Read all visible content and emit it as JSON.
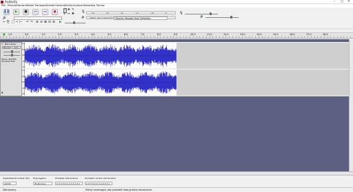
{
  "window": {
    "title": "Audacity",
    "controls": [
      "–",
      "□",
      "✕"
    ]
  },
  "menu": [
    "Plik",
    "Edycja",
    "Zaznacz",
    "Widok",
    "Transport",
    "Ścieżki",
    "Generuj",
    "Efekty",
    "Analiza",
    "Narzędzia",
    "Pomoc"
  ],
  "toolbar": {
    "transport": [
      {
        "name": "pause",
        "glyph": "❚❚"
      },
      {
        "name": "play",
        "glyph": "▶"
      },
      {
        "name": "stop",
        "glyph": "■"
      },
      {
        "name": "skip-start",
        "glyph": "⏮"
      },
      {
        "name": "skip-end",
        "glyph": "⏭"
      },
      {
        "name": "record",
        "glyph": "●"
      }
    ],
    "meter_play_hint": "Kliknij, aby rozpocząć monitorowanie",
    "meter_ticks": [
      "-54",
      "-48",
      "-42",
      "-36",
      "-30",
      "-24",
      "-18",
      "-12",
      "-6",
      "0"
    ],
    "device_combo": "Głośniki (Realtek High Definition"
  },
  "ruler": {
    "ticks": [
      "1,0",
      "0,0",
      "1,0",
      "2,0",
      "3,0",
      "4,0",
      "5,0",
      "6,0",
      "7,0",
      "8,0",
      "9,0",
      "10,0",
      "11,0",
      "12,0",
      "13,0",
      "14,0",
      "15,0",
      "16,0",
      "17,0",
      "18,0"
    ]
  },
  "track": {
    "name": "Bez nazwy",
    "mute": "Wycisz",
    "solo": "Solo",
    "info": "Stereo, 44100Hz\n32-bitowe float",
    "scale": [
      "1,0",
      "0,5",
      "0,0",
      "-0,5",
      "-1,0"
    ]
  },
  "selection": {
    "rate_caption": "Częstotliwość próbek (Hz)",
    "rate_value": "44100",
    "snap_caption": "Przyciąganie",
    "snap_value": "Wyłączone",
    "start_caption": "Początek zaznaczenia",
    "start_value": "0 0 h 0 0 m 0 0,0 0 0 s",
    "end_caption": "Początek i koniec zaznaczenia",
    "end_value": "0 0 h 0 0 m 0 0,0 0 0 s"
  },
  "status": {
    "state": "Zatrzymany.",
    "hint": "Kliknij i przeciągnij, aby przenieść lewą granicę zaznaczenia."
  },
  "colors": {
    "wave": "#3232c8",
    "background": "#5d6080",
    "record": "#cc3366"
  }
}
